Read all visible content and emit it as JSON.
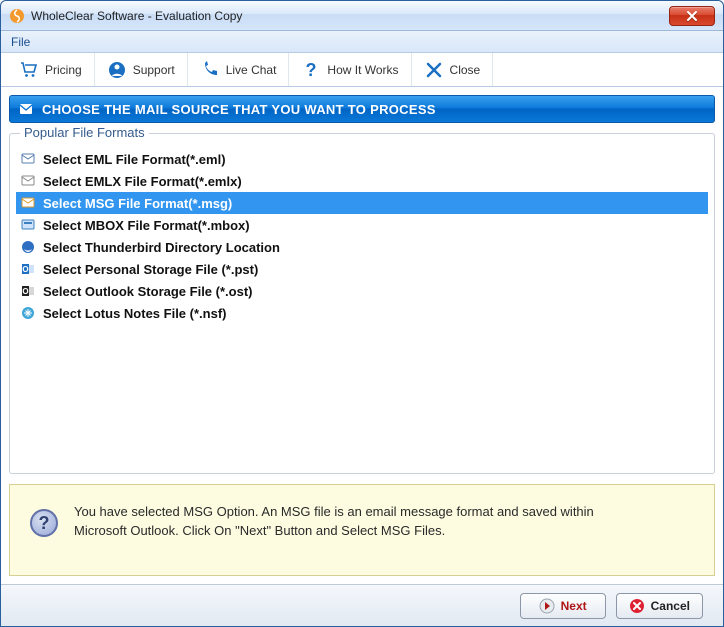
{
  "window": {
    "title": "WholeClear Software - Evaluation Copy"
  },
  "menubar": {
    "file": "File"
  },
  "toolbar": {
    "pricing": "Pricing",
    "support": "Support",
    "livechat": "Live Chat",
    "howitworks": "How It Works",
    "close": "Close"
  },
  "section": {
    "heading": "CHOOSE THE MAIL SOURCE THAT YOU WANT TO PROCESS"
  },
  "groupbox": {
    "legend": "Popular File Formats"
  },
  "formats": {
    "f0": "Select EML File Format(*.eml)",
    "f1": "Select EMLX File Format(*.emlx)",
    "f2": "Select MSG File Format(*.msg)",
    "f3": "Select MBOX File Format(*.mbox)",
    "f4": "Select Thunderbird Directory Location",
    "f5": "Select Personal Storage File (*.pst)",
    "f6": "Select Outlook Storage File (*.ost)",
    "f7": "Select Lotus Notes File (*.nsf)"
  },
  "info": {
    "text": "You have selected MSG Option. An MSG file is an email message format and saved within Microsoft Outlook. Click On \"Next\" Button and Select MSG Files."
  },
  "buttons": {
    "next": "Next",
    "cancel": "Cancel"
  }
}
